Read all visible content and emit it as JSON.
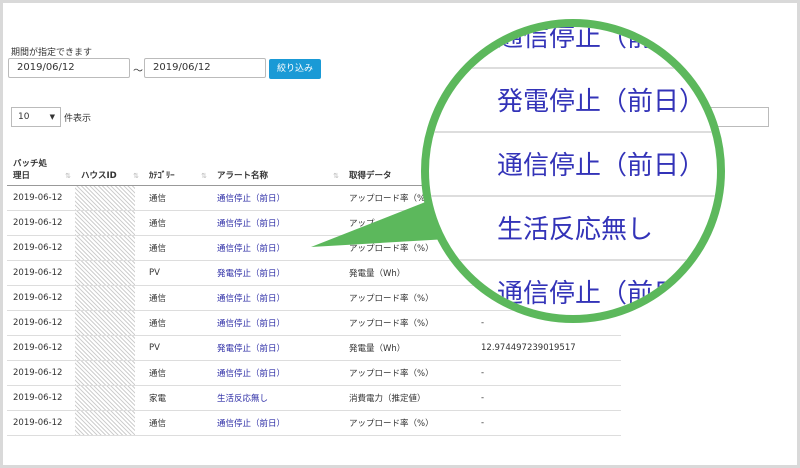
{
  "filter": {
    "period_label": "期間が指定できます",
    "date_from": "2019/06/12",
    "tilde": "～",
    "date_to": "2019/06/12",
    "filter_button": "絞り込み"
  },
  "paging": {
    "page_size": "10",
    "per_page_label": "件表示"
  },
  "table": {
    "headers": {
      "batch_date_line1": "バッチ処",
      "batch_date_line2": "理日",
      "house_id": "ハウスID",
      "category": "ｶﾃｺﾞﾘｰ",
      "alert_name": "アラート名称",
      "data_type": "取得データ"
    },
    "rows": [
      {
        "date": "2019-06-12",
        "category": "通信",
        "alert": "通信停止（前日）",
        "data": "アップロード率（%）",
        "value": ""
      },
      {
        "date": "2019-06-12",
        "category": "通信",
        "alert": "通信停止（前日）",
        "data": "アップ",
        "value": ""
      },
      {
        "date": "2019-06-12",
        "category": "通信",
        "alert": "通信停止（前日）",
        "data": "アップロード率（%）",
        "value": ""
      },
      {
        "date": "2019-06-12",
        "category": "PV",
        "alert": "発電停止（前日）",
        "data": "発電量（Wh）",
        "value": ""
      },
      {
        "date": "2019-06-12",
        "category": "通信",
        "alert": "通信停止（前日）",
        "data": "アップロード率（%）",
        "value": ""
      },
      {
        "date": "2019-06-12",
        "category": "通信",
        "alert": "通信停止（前日）",
        "data": "アップロード率（%）",
        "value": "-"
      },
      {
        "date": "2019-06-12",
        "category": "PV",
        "alert": "発電停止（前日）",
        "data": "発電量（Wh）",
        "value": "12.974497239019517"
      },
      {
        "date": "2019-06-12",
        "category": "通信",
        "alert": "通信停止（前日）",
        "data": "アップロード率（%）",
        "value": "-"
      },
      {
        "date": "2019-06-12",
        "category": "家電",
        "alert": "生活反応無し",
        "data": "消費電力（推定値）",
        "value": "-"
      },
      {
        "date": "2019-06-12",
        "category": "通信",
        "alert": "通信停止（前日）",
        "data": "アップロード率（%）",
        "value": "-"
      }
    ]
  },
  "magnifier": {
    "rows": [
      "通信停止（前日）",
      "発電停止（前日）",
      "通信停止（前日）",
      "生活反応無し",
      "通信停止（前日）"
    ],
    "ring_color": "#5cb85c",
    "link_color": "#3333b8"
  },
  "colors": {
    "button": "#1a9ad6",
    "link": "#2c2ca6"
  }
}
